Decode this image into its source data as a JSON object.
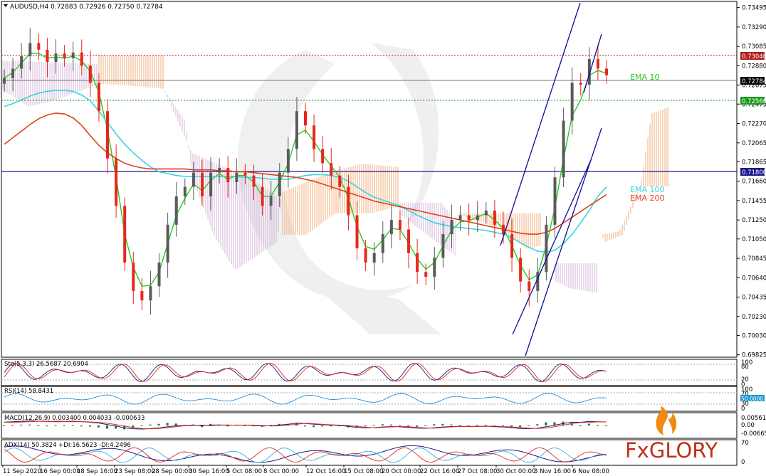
{
  "header": {
    "symbol_line": "AUDUSD,H4  0.72883 0.72926 0.72750 0.72784"
  },
  "colors": {
    "up_candle": "#5a5a5a",
    "down_candle": "#e8261a",
    "ema10": "#22cc22",
    "ema100": "#33d6e0",
    "ema200": "#e0401a",
    "channel": "#0b0b9a",
    "hline": "#1a1a8c",
    "res_dotted": "#b02020",
    "sup_dotted": "#1a9a1a",
    "logo_red": "#c0301a",
    "logo_orange": "#f08a10"
  },
  "legends": {
    "ema10": "EMA 10",
    "ema100": "EMA 100",
    "ema200": "EMA 200"
  },
  "price_tags": {
    "resistance": "0.73040",
    "current": "0.72784",
    "support": "0.72560",
    "level": "0.71800"
  },
  "indicators": {
    "sto": "Sto(5,3,3) 26.5687 20.6904",
    "rsi": "RSI(14) 58.8431",
    "macd": "MACD(12,26,9) 0.003400 0.004033 -0.000633",
    "adx": "ADX(14) 50.3824 +DI:16.5623 -DI:4.2496"
  },
  "indicator_axes": {
    "sto": [
      "100",
      "80",
      "20",
      "0"
    ],
    "rsi": [
      "100",
      "70",
      "50.0000",
      "30",
      "0"
    ],
    "macd": [
      "0.005615",
      "0.00",
      "-0.006659"
    ],
    "adx": [
      "70",
      "0"
    ]
  },
  "logo": {
    "text": "FxGLORY"
  },
  "chart_data": {
    "type": "line",
    "title": "AUDUSD,H4",
    "y_ticks": [
      "0.73495",
      "0.73290",
      "0.73085",
      "0.72880",
      "0.72675",
      "0.72475",
      "0.72270",
      "0.72065",
      "0.71865",
      "0.71660",
      "0.71455",
      "0.71250",
      "0.71050",
      "0.70845",
      "0.70640",
      "0.70435",
      "0.70230",
      "0.70030",
      "0.69825"
    ],
    "ylim": [
      0.698,
      0.7356
    ],
    "x_ticks": [
      "11 Sep 2020",
      "16 Sep 00:00",
      "18 Sep 16:00",
      "23 Sep 08:00",
      "28 Sep 00:00",
      "30 Sep 16:00",
      "5 Oct 08:00",
      "8 Oct 00:00",
      "12 Oct 16:00",
      "15 Oct 08:00",
      "20 Oct 00:00",
      "22 Oct 16:00",
      "27 Oct 08:00",
      "30 Oct 00:00",
      "3 Nov 16:00",
      "6 Nov 08:00"
    ],
    "close": [
      0.7275,
      0.7285,
      0.7298,
      0.7312,
      0.7305,
      0.7292,
      0.7301,
      0.7296,
      0.7302,
      0.7288,
      0.727,
      0.724,
      0.719,
      0.714,
      0.708,
      0.705,
      0.704,
      0.7055,
      0.708,
      0.712,
      0.715,
      0.716,
      0.7175,
      0.715,
      0.7175,
      0.718,
      0.7165,
      0.7175,
      0.7172,
      0.716,
      0.714,
      0.715,
      0.7175,
      0.72,
      0.724,
      0.7225,
      0.72,
      0.7185,
      0.7172,
      0.716,
      0.713,
      0.7095,
      0.708,
      0.709,
      0.711,
      0.7125,
      0.7115,
      0.709,
      0.707,
      0.7065,
      0.7085,
      0.711,
      0.7125,
      0.713,
      0.7125,
      0.713,
      0.7135,
      0.712,
      0.711,
      0.7085,
      0.706,
      0.705,
      0.707,
      0.712,
      0.717,
      0.723,
      0.727,
      0.7268,
      0.7295,
      0.7285,
      0.7278
    ],
    "series": [
      {
        "name": "EMA 10",
        "values": [
          0.7275,
          0.7281,
          0.7291,
          0.7301,
          0.7301,
          0.7296,
          0.7297,
          0.7296,
          0.7298,
          0.7293,
          0.7282,
          0.726,
          0.722,
          0.717,
          0.711,
          0.7075,
          0.7055,
          0.7056,
          0.707,
          0.71,
          0.713,
          0.7148,
          0.7163,
          0.7156,
          0.7167,
          0.7174,
          0.7168,
          0.7172,
          0.7172,
          0.7165,
          0.715,
          0.715,
          0.7165,
          0.7185,
          0.7215,
          0.722,
          0.7208,
          0.7194,
          0.7182,
          0.717,
          0.7148,
          0.7118,
          0.7097,
          0.7094,
          0.7104,
          0.7116,
          0.7115,
          0.7101,
          0.7084,
          0.7073,
          0.708,
          0.7098,
          0.7114,
          0.7123,
          0.7124,
          0.7128,
          0.7132,
          0.7125,
          0.7116,
          0.7098,
          0.7077,
          0.7062,
          0.7067,
          0.7098,
          0.7138,
          0.719,
          0.7235,
          0.7252,
          0.7278,
          0.7283,
          0.728
        ]
      },
      {
        "name": "EMA 100",
        "values": [
          0.7245,
          0.7248,
          0.7252,
          0.7256,
          0.7259,
          0.7261,
          0.7262,
          0.7262,
          0.7261,
          0.7257,
          0.7251,
          0.724,
          0.7228,
          0.7216,
          0.7205,
          0.7196,
          0.7188,
          0.7181,
          0.7176,
          0.7174,
          0.7172,
          0.7171,
          0.7171,
          0.7171,
          0.7171,
          0.7171,
          0.7171,
          0.7171,
          0.717,
          0.717,
          0.7169,
          0.7168,
          0.7168,
          0.7168,
          0.717,
          0.7172,
          0.7173,
          0.7173,
          0.7172,
          0.717,
          0.7166,
          0.716,
          0.7154,
          0.7149,
          0.7146,
          0.7143,
          0.714,
          0.7135,
          0.713,
          0.7126,
          0.7122,
          0.712,
          0.7118,
          0.7117,
          0.7116,
          0.7115,
          0.7114,
          0.7112,
          0.711,
          0.7106,
          0.7101,
          0.7096,
          0.7092,
          0.7091,
          0.7093,
          0.71,
          0.711,
          0.7122,
          0.7135,
          0.715,
          0.716
        ]
      },
      {
        "name": "EMA 200",
        "values": [
          0.7205,
          0.7212,
          0.7219,
          0.7226,
          0.7232,
          0.7236,
          0.7238,
          0.7237,
          0.7233,
          0.7225,
          0.7214,
          0.7204,
          0.7196,
          0.719,
          0.7185,
          0.7182,
          0.718,
          0.7179,
          0.7179,
          0.7179,
          0.7179,
          0.7179,
          0.7178,
          0.7178,
          0.7178,
          0.7177,
          0.7177,
          0.7176,
          0.7176,
          0.7175,
          0.7174,
          0.7173,
          0.7172,
          0.7171,
          0.717,
          0.7168,
          0.7166,
          0.7163,
          0.716,
          0.7157,
          0.7154,
          0.7151,
          0.7148,
          0.7145,
          0.7143,
          0.7141,
          0.7139,
          0.7137,
          0.7135,
          0.7133,
          0.7131,
          0.7129,
          0.7127,
          0.7125,
          0.7123,
          0.7121,
          0.7119,
          0.7117,
          0.7115,
          0.7113,
          0.7111,
          0.711,
          0.711,
          0.7112,
          0.7116,
          0.7122,
          0.7128,
          0.7134,
          0.714,
          0.7146,
          0.7152
        ]
      }
    ],
    "horizontal_levels": [
      0.7304,
      0.72784,
      0.7256,
      0.718
    ],
    "grid": false
  }
}
